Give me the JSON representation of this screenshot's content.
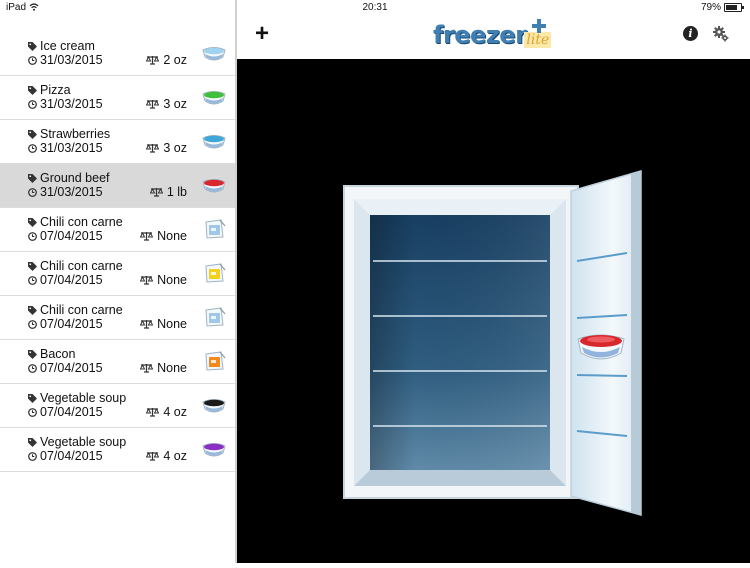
{
  "status": {
    "device": "iPad",
    "time": "20:31",
    "battery": "79%",
    "battery_level": 0.79
  },
  "toolbar": {
    "add_label": "+",
    "logo_main": "freezer",
    "logo_sub": "lite",
    "info_label": "i"
  },
  "colors": {
    "selected_row": "#d9d9d9",
    "logo_blue": "#3f7fb4",
    "freezer_inner": "#2c5a7e",
    "background": "#000000"
  },
  "items": [
    {
      "name": "Ice cream",
      "date": "31/03/2015",
      "weight": "2 oz",
      "container": "bowl",
      "color": "#9fd3ee"
    },
    {
      "name": "Pizza",
      "date": "31/03/2015",
      "weight": "3 oz",
      "container": "bowl",
      "color": "#3fbf3a"
    },
    {
      "name": "Strawberries",
      "date": "31/03/2015",
      "weight": "3 oz",
      "container": "bowl",
      "color": "#3fa6d8"
    },
    {
      "name": "Ground beef",
      "date": "31/03/2015",
      "weight": "1 lb",
      "container": "bowl",
      "color": "#d8282e",
      "selected": true
    },
    {
      "name": "Chili con carne",
      "date": "07/04/2015",
      "weight": "None",
      "container": "bag",
      "color": "#9fc7e8"
    },
    {
      "name": "Chili con carne",
      "date": "07/04/2015",
      "weight": "None",
      "container": "bag",
      "color": "#f2d21f"
    },
    {
      "name": "Chili con carne",
      "date": "07/04/2015",
      "weight": "None",
      "container": "bag",
      "color": "#9fc7e8"
    },
    {
      "name": "Bacon",
      "date": "07/04/2015",
      "weight": "None",
      "container": "bag",
      "color": "#f28a1f"
    },
    {
      "name": "Vegetable soup",
      "date": "07/04/2015",
      "weight": "4 oz",
      "container": "bowl",
      "color": "#1a1a1a"
    },
    {
      "name": "Vegetable soup",
      "date": "07/04/2015",
      "weight": "4 oz",
      "container": "bowl",
      "color": "#8a2fc4"
    }
  ]
}
